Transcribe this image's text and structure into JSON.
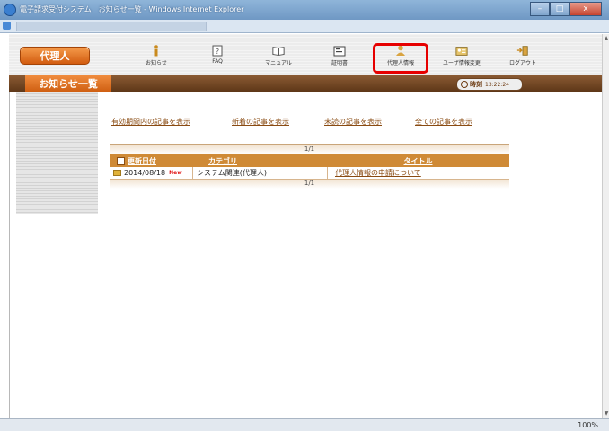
{
  "window": {
    "title": "電子請求受付システム　お知らせ一覧 - Windows Internet Explorer",
    "min_label": "–",
    "max_label": "□",
    "close_label": "x"
  },
  "toolbar": {
    "role_label": "代理人",
    "items": [
      {
        "label": "お知らせ",
        "icon": "info-icon"
      },
      {
        "label": "FAQ",
        "icon": "faq-icon"
      },
      {
        "label": "マニュアル",
        "icon": "book-icon"
      },
      {
        "label": "証明書",
        "icon": "certificate-icon"
      },
      {
        "label": "代理人情報",
        "icon": "person-icon"
      },
      {
        "label": "ユーザ情報変更",
        "icon": "user-card-icon"
      },
      {
        "label": "ログアウト",
        "icon": "logout-icon"
      }
    ]
  },
  "header": {
    "tab_label": "お知らせ一覧",
    "time_label": "時刻",
    "time_value": "13:22:24"
  },
  "filters": [
    "有効期間内の記事を表示",
    "新着の記事を表示",
    "未読の記事を表示",
    "全ての記事を表示"
  ],
  "table": {
    "pager_top": "1/1",
    "pager_bottom": "1/1",
    "columns": [
      "更新日付",
      "カテゴリ",
      "タイトル"
    ],
    "rows": [
      {
        "date": "2014/08/18",
        "badge": "New",
        "category": "システム関連(代理人)",
        "title": "代理人情報の申請について"
      }
    ]
  },
  "status": {
    "zoom": "100%"
  },
  "colors": {
    "accent_orange": "#d25c10",
    "header_brown": "#5e3718",
    "highlight_red": "#e60000"
  }
}
